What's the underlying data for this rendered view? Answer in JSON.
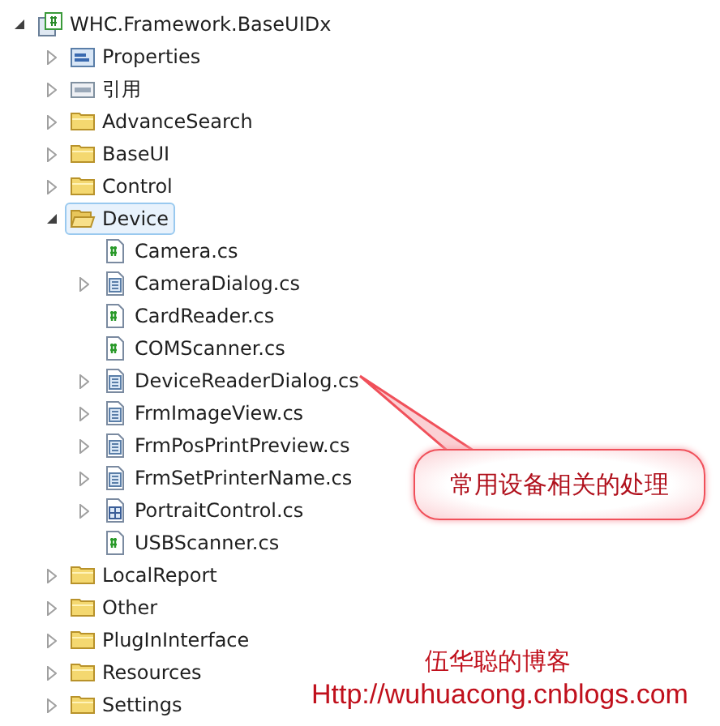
{
  "tree": [
    {
      "label": "WHC.Framework.BaseUIDx",
      "kind": "project",
      "expanded": true,
      "selected": false,
      "children": [
        {
          "label": "Properties",
          "kind": "properties",
          "expanded": false,
          "selected": false
        },
        {
          "label": "引用",
          "kind": "references",
          "expanded": false,
          "selected": false
        },
        {
          "label": "AdvanceSearch",
          "kind": "folder",
          "expanded": false,
          "selected": false
        },
        {
          "label": "BaseUI",
          "kind": "folder",
          "expanded": false,
          "selected": false
        },
        {
          "label": "Control",
          "kind": "folder",
          "expanded": false,
          "selected": false
        },
        {
          "label": "Device",
          "kind": "folder",
          "expanded": true,
          "selected": true,
          "children": [
            {
              "label": "Camera.cs",
              "kind": "cs",
              "selected": false
            },
            {
              "label": "CameraDialog.cs",
              "kind": "form",
              "expanded": false,
              "selected": false
            },
            {
              "label": "CardReader.cs",
              "kind": "cs",
              "selected": false
            },
            {
              "label": "COMScanner.cs",
              "kind": "cs",
              "selected": false
            },
            {
              "label": "DeviceReaderDialog.cs",
              "kind": "form",
              "expanded": false,
              "selected": false
            },
            {
              "label": "FrmImageView.cs",
              "kind": "form",
              "expanded": false,
              "selected": false
            },
            {
              "label": "FrmPosPrintPreview.cs",
              "kind": "form",
              "expanded": false,
              "selected": false
            },
            {
              "label": "FrmSetPrinterName.cs",
              "kind": "form",
              "expanded": false,
              "selected": false
            },
            {
              "label": "PortraitControl.cs",
              "kind": "control",
              "expanded": false,
              "selected": false
            },
            {
              "label": "USBScanner.cs",
              "kind": "cs",
              "selected": false
            }
          ]
        },
        {
          "label": "LocalReport",
          "kind": "folder",
          "expanded": false,
          "selected": false
        },
        {
          "label": "Other",
          "kind": "folder",
          "expanded": false,
          "selected": false
        },
        {
          "label": "PlugInInterface",
          "kind": "folder",
          "expanded": false,
          "selected": false
        },
        {
          "label": "Resources",
          "kind": "folder",
          "expanded": false,
          "selected": false
        },
        {
          "label": "Settings",
          "kind": "folder",
          "expanded": false,
          "selected": false
        }
      ]
    }
  ],
  "callout": {
    "text": "常用设备相关的处理"
  },
  "blog_title": "伍华聪的博客",
  "blog_url": "Http://wuhuacong.cnblogs.com"
}
